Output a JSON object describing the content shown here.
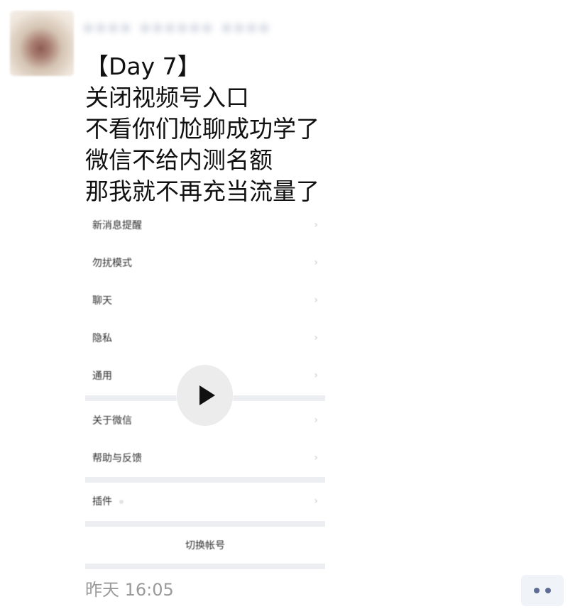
{
  "post": {
    "username": "•••• •••••• ••••",
    "lines": [
      "【Day 7】",
      "关闭视频号入口",
      "不看你们尬聊成功学了",
      "微信不给内测名额",
      "那我就不再充当流量了"
    ],
    "timestamp": "昨天 16:05"
  },
  "settings_screenshot": {
    "rows": [
      "新消息提醒",
      "勿扰模式",
      "聊天",
      "隐私",
      "通用",
      "关于微信",
      "帮助与反馈",
      "插件"
    ],
    "switch_account": "切换帐号",
    "chevron": "›"
  },
  "icons": {
    "avatar": "avatar-image",
    "play": "play-icon",
    "more": "more-icon"
  },
  "colors": {
    "timestamp": "#9a9a9a",
    "more_button_bg": "#f0f3f8",
    "more_dots": "#5d6d93"
  }
}
